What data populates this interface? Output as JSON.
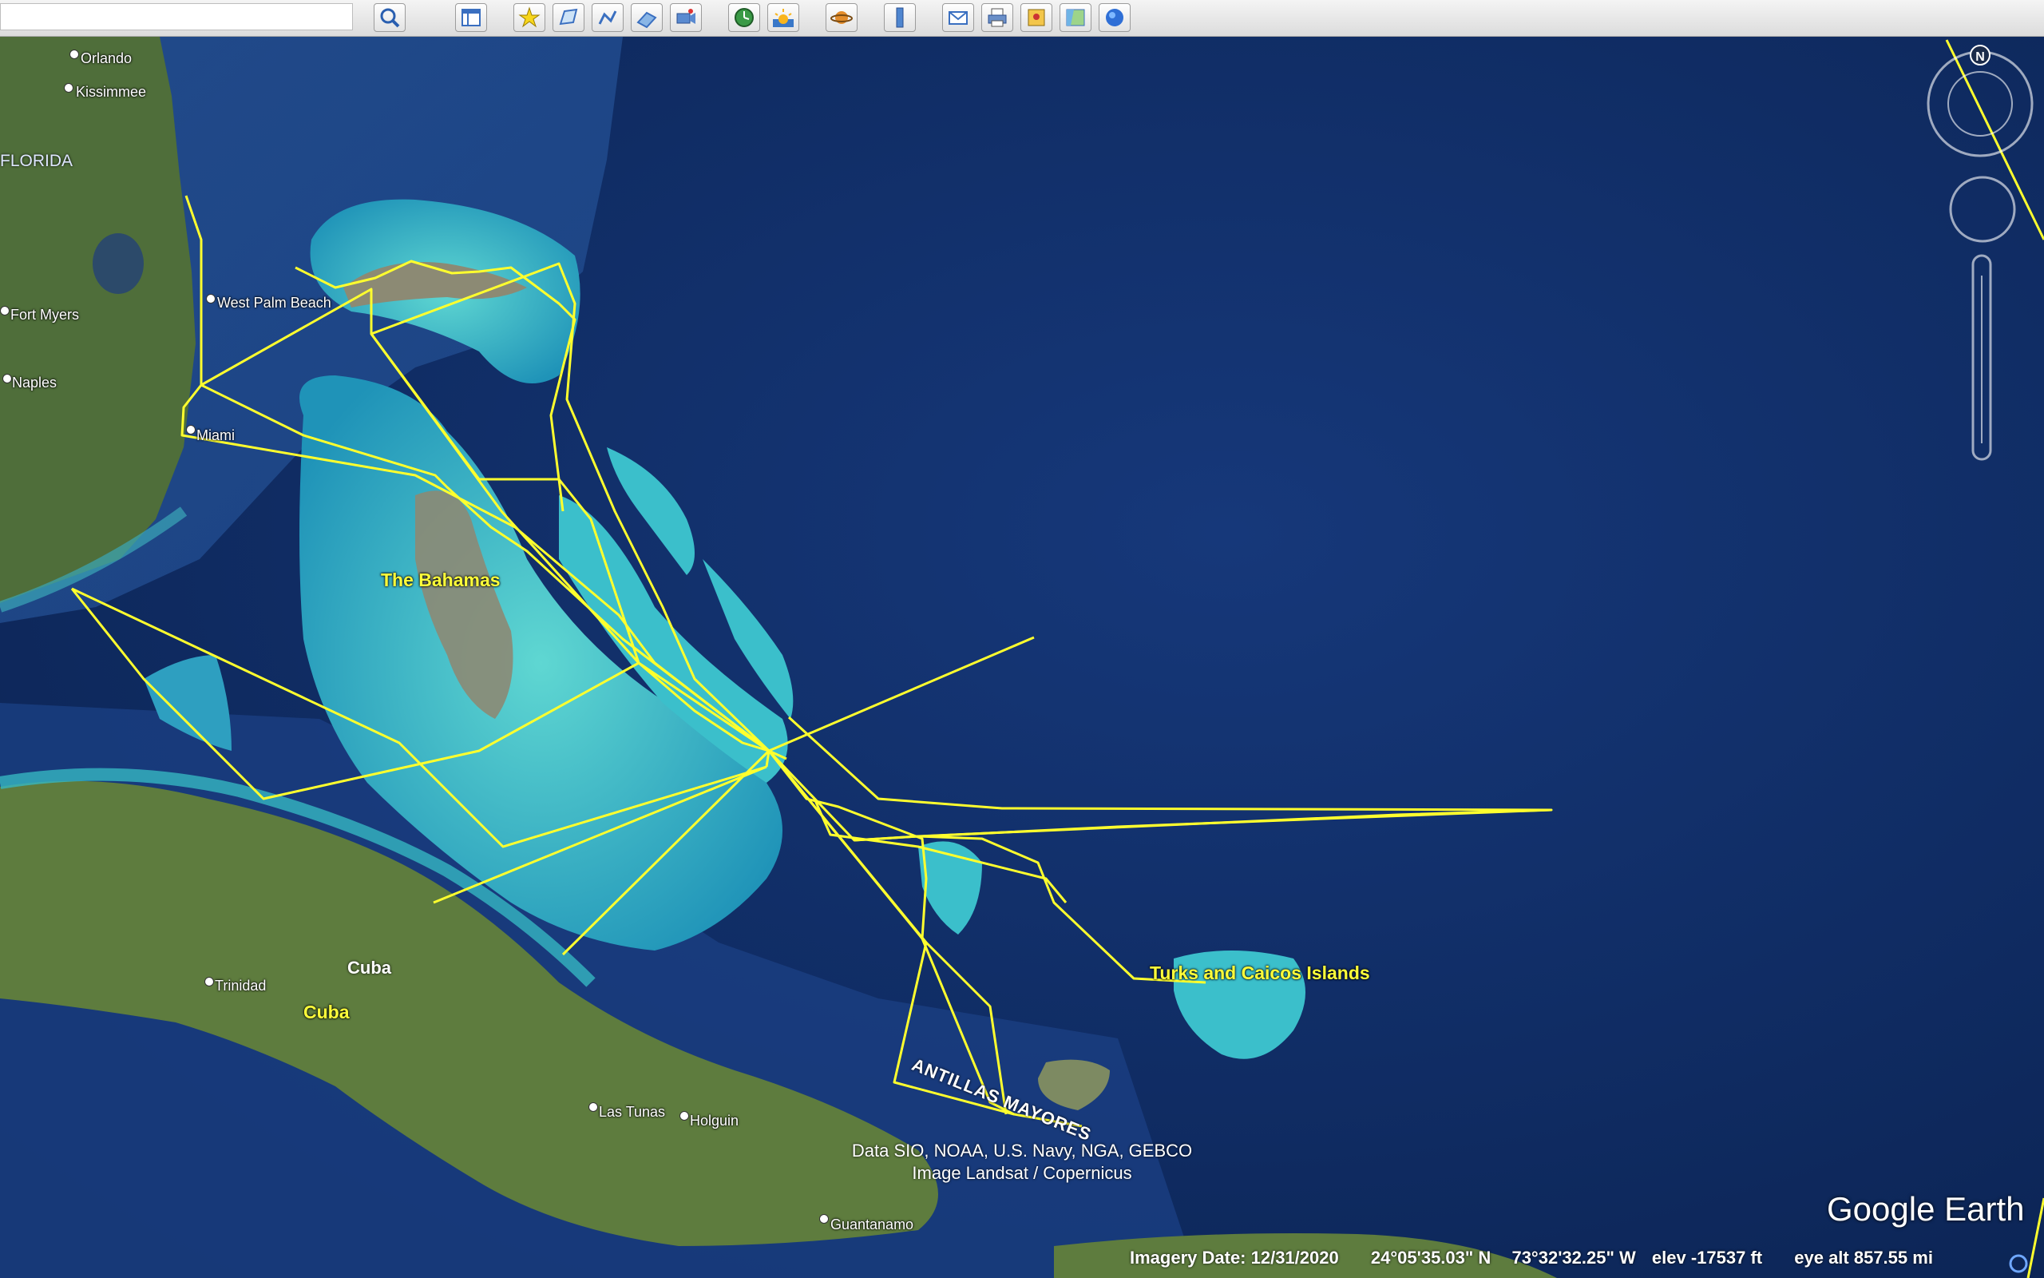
{
  "search": {
    "value": "",
    "placeholder": ""
  },
  "toolbar": {
    "buttons": [
      {
        "name": "search-button",
        "icon": "magnifier-icon"
      },
      {
        "name": "sidebar-button",
        "icon": "sidebar-icon"
      },
      {
        "name": "add-placemark-button",
        "icon": "pushpin-icon"
      },
      {
        "name": "add-polygon-button",
        "icon": "polygon-icon"
      },
      {
        "name": "add-path-button",
        "icon": "path-icon"
      },
      {
        "name": "add-image-overlay-button",
        "icon": "image-overlay-icon"
      },
      {
        "name": "record-tour-button",
        "icon": "camera-icon"
      },
      {
        "name": "historical-imagery-button",
        "icon": "clock-icon"
      },
      {
        "name": "sunlight-button",
        "icon": "sun-icon"
      },
      {
        "name": "switch-planet-button",
        "icon": "planet-icon"
      },
      {
        "name": "ruler-button",
        "icon": "ruler-icon"
      },
      {
        "name": "email-button",
        "icon": "envelope-icon"
      },
      {
        "name": "print-button",
        "icon": "printer-icon"
      },
      {
        "name": "save-image-button",
        "icon": "save-image-icon"
      },
      {
        "name": "view-in-maps-button",
        "icon": "map-icon"
      },
      {
        "name": "earth-gallery-button",
        "icon": "globe-icon"
      }
    ]
  },
  "labels": {
    "orlando": "Orlando",
    "kissimmee": "Kissimmee",
    "florida": "FLORIDA",
    "fort_myers": "Fort Myers",
    "west_palm_beach": "West Palm Beach",
    "naples": "Naples",
    "miami": "Miami",
    "bahamas": "The Bahamas",
    "cuba_white": "Cuba",
    "cuba_yellow": "Cuba",
    "trinidad": "Trinidad",
    "turks_caicos": "Turks and Caicos Islands",
    "antillas": "ANTILLAS MAYORES",
    "las_tunas": "Las Tunas",
    "holguin": "Holguin",
    "guantanamo": "Guantanamo"
  },
  "attribution": {
    "line1": "Data SIO, NOAA, U.S. Navy, NGA, GEBCO",
    "line2": "Image Landsat / Copernicus"
  },
  "status": {
    "imagery_date": "Imagery Date: 12/31/2020",
    "lat": "24°05'35.03\" N",
    "lon": "73°32'32.25\" W",
    "elev": "elev -17537 ft",
    "eye_alt": "eye alt 857.55 mi"
  },
  "logo": "Google Earth",
  "compass_north": "N",
  "colors": {
    "track": "#ffff2e",
    "ocean_deep": "#0e2a5c",
    "shallow": "#39c4c8",
    "land": "#5c7b3c"
  }
}
